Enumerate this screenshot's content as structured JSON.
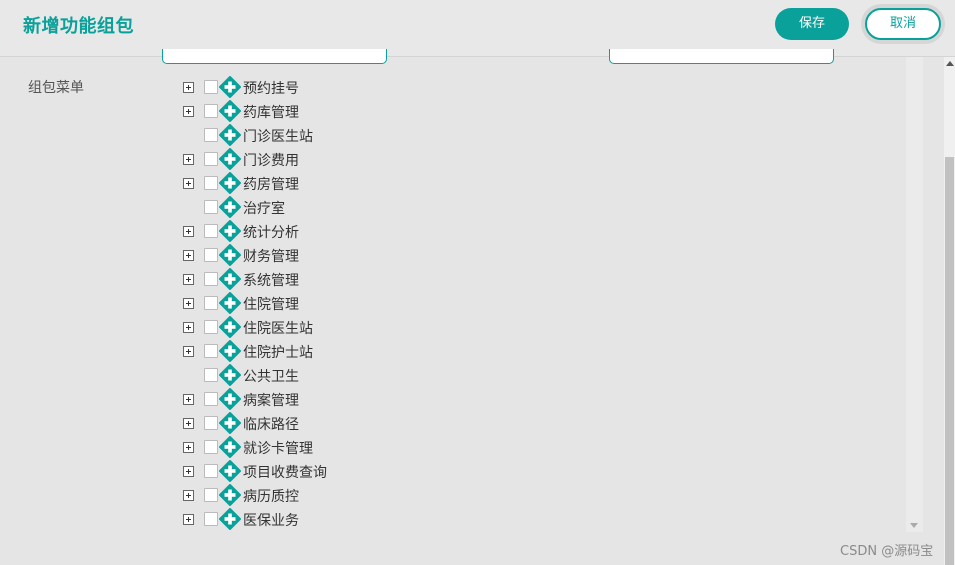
{
  "header": {
    "title": "新增功能组包",
    "save_label": "保存",
    "cancel_label": "取消"
  },
  "form": {
    "menu_label": "组包菜单"
  },
  "tree": {
    "items": [
      {
        "label": "预约挂号",
        "expandable": true
      },
      {
        "label": "药库管理",
        "expandable": true
      },
      {
        "label": "门诊医生站",
        "expandable": false
      },
      {
        "label": "门诊费用",
        "expandable": true
      },
      {
        "label": "药房管理",
        "expandable": true
      },
      {
        "label": "治疗室",
        "expandable": false
      },
      {
        "label": "统计分析",
        "expandable": true
      },
      {
        "label": "财务管理",
        "expandable": true
      },
      {
        "label": "系统管理",
        "expandable": true
      },
      {
        "label": "住院管理",
        "expandable": true
      },
      {
        "label": "住院医生站",
        "expandable": true
      },
      {
        "label": "住院护士站",
        "expandable": true
      },
      {
        "label": "公共卫生",
        "expandable": false
      },
      {
        "label": "病案管理",
        "expandable": true
      },
      {
        "label": "临床路径",
        "expandable": true
      },
      {
        "label": "就诊卡管理",
        "expandable": true
      },
      {
        "label": "项目收费查询",
        "expandable": true
      },
      {
        "label": "病历质控",
        "expandable": true
      },
      {
        "label": "医保业务",
        "expandable": true
      }
    ]
  },
  "watermark": "CSDN @源码宝",
  "colors": {
    "accent": "#0aa19a",
    "background": "#e5e5e5"
  },
  "icons": {
    "node": "plus-diamond-icon",
    "expander": "expand-plus-icon"
  }
}
